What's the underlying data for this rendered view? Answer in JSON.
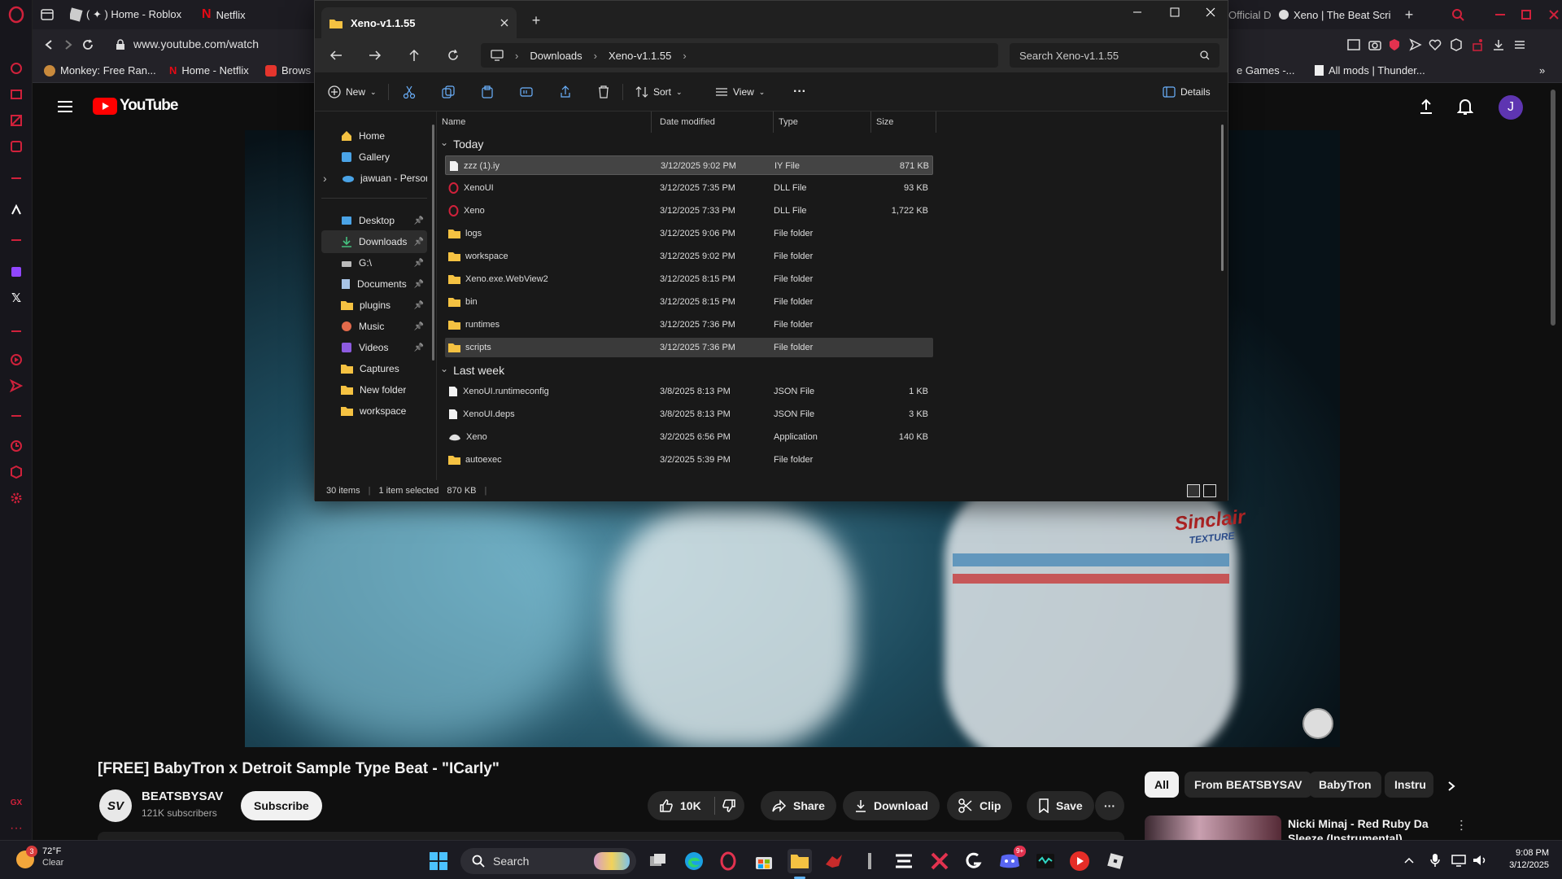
{
  "browser": {
    "tabs": [
      {
        "label": "( ✦ ) Home - Roblox"
      },
      {
        "label": "Netflix"
      },
      {
        "label": "Official D"
      },
      {
        "label": "Xeno | The Beat Scri"
      }
    ],
    "url": "www.youtube.com/watch",
    "bookmarks": [
      {
        "label": "Monkey: Free Ran..."
      },
      {
        "label": "Home - Netflix"
      },
      {
        "label": "Brows"
      },
      {
        "label": "e Games -..."
      },
      {
        "label": "All mods | Thunder..."
      }
    ]
  },
  "explorer": {
    "tab_title": "Xeno-v1.1.55",
    "breadcrumb": [
      "Downloads",
      "Xeno-v1.1.55"
    ],
    "search_placeholder": "Search Xeno-v1.1.55",
    "toolbar": {
      "new_label": "New",
      "sort_label": "Sort",
      "view_label": "View",
      "details_label": "Details"
    },
    "nav_pane": [
      {
        "label": "Home",
        "icon": "home-icon",
        "pinned": false
      },
      {
        "label": "Gallery",
        "icon": "gallery-icon",
        "pinned": false
      },
      {
        "label": "jawuan - Person",
        "icon": "onedrive-icon",
        "pinned": false
      },
      {
        "label": "Desktop",
        "icon": "desktop-icon",
        "pinned": true
      },
      {
        "label": "Downloads",
        "icon": "download-icon",
        "pinned": true
      },
      {
        "label": "G:\\",
        "icon": "drive-icon",
        "pinned": true
      },
      {
        "label": "Documents",
        "icon": "document-icon",
        "pinned": true
      },
      {
        "label": "plugins",
        "icon": "folder-icon",
        "pinned": true
      },
      {
        "label": "Music",
        "icon": "music-icon",
        "pinned": true
      },
      {
        "label": "Videos",
        "icon": "video-icon",
        "pinned": true
      },
      {
        "label": "Captures",
        "icon": "folder-icon",
        "pinned": false
      },
      {
        "label": "New folder",
        "icon": "folder-icon",
        "pinned": false
      },
      {
        "label": "workspace",
        "icon": "folder-icon",
        "pinned": false
      }
    ],
    "columns": {
      "name": "Name",
      "date": "Date modified",
      "type": "Type",
      "size": "Size"
    },
    "groups": [
      {
        "label": "Today",
        "files": [
          {
            "name": "zzz (1).iy",
            "date": "3/12/2025 9:02 PM",
            "type": "IY File",
            "size": "871 KB",
            "icon": "file",
            "selected": true
          },
          {
            "name": "XenoUI",
            "date": "3/12/2025 7:35 PM",
            "type": "DLL File",
            "size": "93 KB",
            "icon": "opera",
            "selected": false
          },
          {
            "name": "Xeno",
            "date": "3/12/2025 7:33 PM",
            "type": "DLL File",
            "size": "1,722 KB",
            "icon": "opera",
            "selected": false
          },
          {
            "name": "logs",
            "date": "3/12/2025 9:06 PM",
            "type": "File folder",
            "size": "",
            "icon": "folder",
            "selected": false
          },
          {
            "name": "workspace",
            "date": "3/12/2025 9:02 PM",
            "type": "File folder",
            "size": "",
            "icon": "folder",
            "selected": false
          },
          {
            "name": "Xeno.exe.WebView2",
            "date": "3/12/2025 8:15 PM",
            "type": "File folder",
            "size": "",
            "icon": "folder",
            "selected": false
          },
          {
            "name": "bin",
            "date": "3/12/2025 8:15 PM",
            "type": "File folder",
            "size": "",
            "icon": "folder",
            "selected": false
          },
          {
            "name": "runtimes",
            "date": "3/12/2025 7:36 PM",
            "type": "File folder",
            "size": "",
            "icon": "folder",
            "selected": false
          },
          {
            "name": "scripts",
            "date": "3/12/2025 7:36 PM",
            "type": "File folder",
            "size": "",
            "icon": "folder",
            "selected": false,
            "hover": true
          }
        ]
      },
      {
        "label": "Last week",
        "files": [
          {
            "name": "XenoUI.runtimeconfig",
            "date": "3/8/2025 8:13 PM",
            "type": "JSON File",
            "size": "1 KB",
            "icon": "file",
            "selected": false
          },
          {
            "name": "XenoUI.deps",
            "date": "3/8/2025 8:13 PM",
            "type": "JSON File",
            "size": "3 KB",
            "icon": "file",
            "selected": false
          },
          {
            "name": "Xeno",
            "date": "3/2/2025 6:56 PM",
            "type": "Application",
            "size": "140 KB",
            "icon": "app",
            "selected": false
          },
          {
            "name": "autoexec",
            "date": "3/2/2025 5:39 PM",
            "type": "File folder",
            "size": "",
            "icon": "folder",
            "selected": false
          }
        ]
      }
    ],
    "status": {
      "items": "30 items",
      "selected": "1 item selected",
      "size": "870 KB"
    }
  },
  "youtube": {
    "logo_text": "YouTube",
    "avatar_letter": "J",
    "video_title": "[FREE] BabyTron x Detroit Sample Type Beat - \"ICarly\"",
    "channel_name": "BEATSBYSAV",
    "channel_initials": "SV",
    "subscribers": "121K subscribers",
    "subscribe_label": "Subscribe",
    "like_count": "10K",
    "share_label": "Share",
    "download_label": "Download",
    "clip_label": "Clip",
    "save_label": "Save",
    "video_overlay": {
      "jersey_text": "Sinclair",
      "jersey_sub": "TEXTURE"
    },
    "chips": [
      "All",
      "From BEATSBYSAV",
      "BabyTron",
      "Instru"
    ],
    "suggested": {
      "title": "Nicki Minaj - Red Ruby Da",
      "title_line2": "Sleeze (Instrumental)"
    }
  },
  "taskbar": {
    "weather_temp": "72°F",
    "weather_desc": "Clear",
    "weather_badge": "3",
    "search_label": "Search",
    "discord_badge": "9+",
    "time": "9:08 PM",
    "date": "3/12/2025"
  },
  "colors": {
    "opera_red": "#d0213b",
    "yt_red": "#ff0000",
    "folder_yellow": "#f5c242",
    "accent_blue": "#0078d4",
    "avatar_purple": "#5e35b1"
  }
}
